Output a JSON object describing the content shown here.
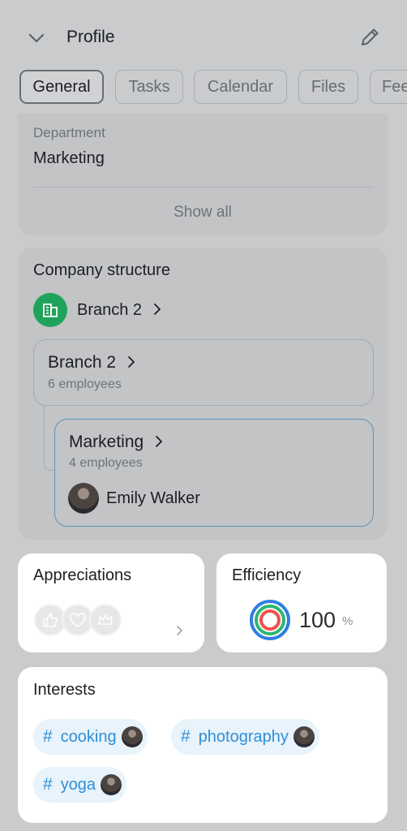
{
  "header": {
    "title": "Profile"
  },
  "tabs": [
    {
      "label": "General"
    },
    {
      "label": "Tasks"
    },
    {
      "label": "Calendar"
    },
    {
      "label": "Files"
    },
    {
      "label": "Fee"
    }
  ],
  "info": {
    "department_label": "Department",
    "department_value": "Marketing",
    "show_all": "Show all"
  },
  "company": {
    "title": "Company structure",
    "root_branch": "Branch 2",
    "branch_box": {
      "name": "Branch 2",
      "count": "6 employees"
    },
    "dept_box": {
      "name": "Marketing",
      "count": "4 employees",
      "employee": "Emily Walker"
    }
  },
  "appreciations": {
    "title": "Appreciations"
  },
  "efficiency": {
    "title": "Efficiency",
    "value": "100",
    "unit": "%"
  },
  "interests": {
    "title": "Interests",
    "tags": [
      "cooking",
      "photography",
      "yoga"
    ]
  },
  "colors": {
    "accent": "#2f8fd8",
    "branch_green": "#1fa35a"
  }
}
